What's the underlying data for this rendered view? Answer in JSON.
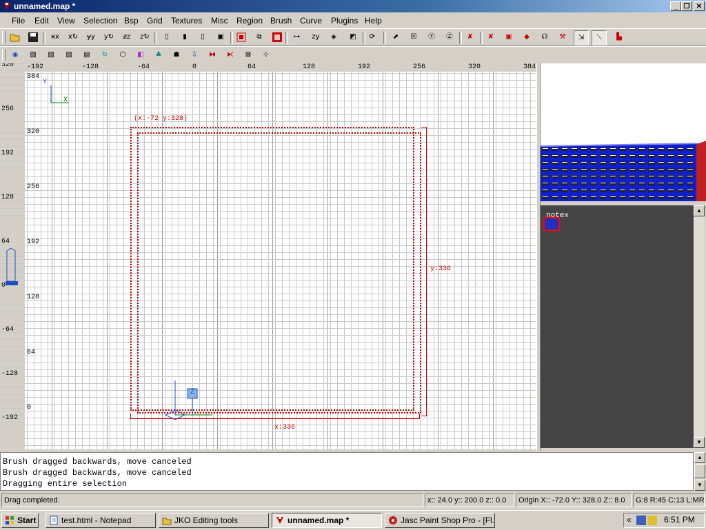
{
  "window": {
    "title": "unnamed.map *",
    "min": "_",
    "max": "❐",
    "close": "✕"
  },
  "menu": [
    "File",
    "Edit",
    "View",
    "Selection",
    "Bsp",
    "Grid",
    "Textures",
    "Misc",
    "Region",
    "Brush",
    "Curve",
    "Plugins",
    "Help"
  ],
  "toolbar1": [
    "open",
    "save",
    "flip-x",
    "rotate-x",
    "flip-y",
    "rotate-y",
    "flip-z",
    "rotate-z",
    "select-complete-tall",
    "select-touching",
    "select-partial-tall",
    "select-inside",
    "csg-subtract",
    "csg-merge",
    "hollow",
    "scale",
    "camera-clip",
    "clipper",
    "face-edit",
    "make-detail",
    "make-structural",
    "texture-lock",
    "rotate-lock",
    "entity",
    "show-patch",
    "brush-3",
    "brush-4",
    "patch",
    "cube",
    "dont-select-model",
    "dont-select-curve"
  ],
  "toolbar2": [
    "brush-icon",
    "patch-1",
    "patch-2",
    "patch-3",
    "patch-4",
    "refresh",
    "hexagon",
    "texture",
    "tree",
    "entity-monster",
    "drop",
    "flip-red",
    "mirror",
    "x-box",
    "misc-tool"
  ],
  "hruler": [
    "-192",
    "-128",
    "-64",
    "0",
    "64",
    "128",
    "192",
    "256",
    "320",
    "384"
  ],
  "vruler": [
    "320",
    "256",
    "192",
    "128",
    "64",
    "0",
    "-64",
    "-128",
    "-192"
  ],
  "grid_labels": [
    "384",
    "320",
    "256",
    "192",
    "128",
    "64",
    "0"
  ],
  "axis": {
    "y": "Y",
    "x": "X",
    "z": "Z"
  },
  "selection": {
    "corner_label": "(x:-72  y:328)",
    "width_label": "x:336",
    "height_label": "y:336"
  },
  "texture_panel": {
    "texture_name": "notex"
  },
  "console": {
    "lines": [
      "Brush dragged backwards, move canceled",
      "Brush dragged backwards, move canceled",
      "Dragging entire selection"
    ]
  },
  "status": {
    "message": "Drag completed.",
    "coords": "x:: 24.0  y:: 200.0  z:: 0.0",
    "origin": "Origin X:: -72.0  Y:: 328.0  Z:: 8.0",
    "grid": "G:8 R:45 C:13 L:MR"
  },
  "taskbar": {
    "start": "Start",
    "tasks": [
      "test.html - Notepad",
      "JKO Editing tools",
      "unnamed.map *",
      "Jasc Paint Shop Pro - [Fl..."
    ],
    "clock": "6:51 PM",
    "tray_arrow": "«"
  },
  "colors": {
    "selection": "#cc0000",
    "grid_major": "#9a9a9a",
    "grid_minor": "#c8c8c8",
    "titlebar": "#0a246a",
    "texture_panel": "#444444"
  }
}
